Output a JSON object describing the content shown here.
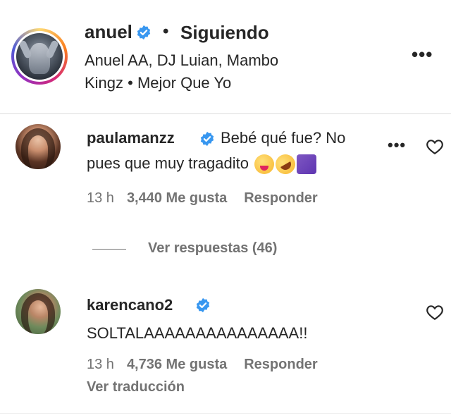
{
  "post": {
    "username": "anuel",
    "separator": "•",
    "follow_status": "Siguiendo",
    "song": "Anuel AA, DJ Luian, Mambo Kingz • Mejor Que Yo",
    "more": "•••"
  },
  "comments": [
    {
      "username": "paulamanzz",
      "text": "Bebé qué fue? No pues que muy tragadito",
      "emojis": [
        "zany-face",
        "rofl-face",
        "musical-notes"
      ],
      "time": "13 h",
      "likes": "3,440 Me gusta",
      "reply": "Responder",
      "more": "•••",
      "view_replies": "Ver respuestas (46)"
    },
    {
      "username": "karencano2",
      "text": "SOLTALAAAAAAAAAAAAAAA!!",
      "time": "13 h",
      "likes": "4,736 Me gusta",
      "reply": "Responder",
      "translate": "Ver traducción"
    }
  ],
  "colors": {
    "verified": "#3897f0",
    "text": "#262626",
    "secondary": "#737373",
    "divider": "#dbdbdb"
  },
  "icons": [
    "verified-badge-icon",
    "more-options-icon",
    "heart-icon"
  ]
}
